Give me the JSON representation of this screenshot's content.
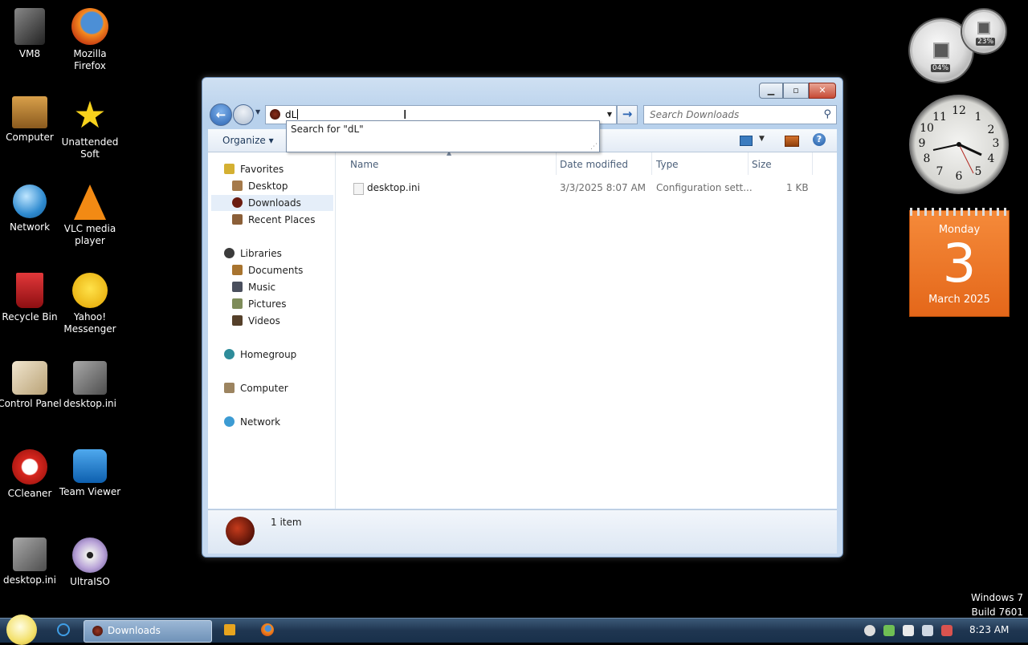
{
  "desktop": {
    "icons": [
      {
        "label": "VM8"
      },
      {
        "label": "Mozilla Firefox"
      },
      {
        "label": "Computer"
      },
      {
        "label": "Unattended Soft"
      },
      {
        "label": "Network"
      },
      {
        "label": "VLC media player"
      },
      {
        "label": "Recycle Bin"
      },
      {
        "label": "Yahoo! Messenger"
      },
      {
        "label": "Control Panel"
      },
      {
        "label": "desktop.ini"
      },
      {
        "label": "CCleaner"
      },
      {
        "label": "Team Viewer"
      },
      {
        "label": "desktop.ini"
      },
      {
        "label": "UltraISO"
      }
    ]
  },
  "gadgets": {
    "cpu_meter": {
      "cpu": "04%",
      "memory": "23%"
    },
    "clock_numbers": [
      "12",
      "1",
      "2",
      "3",
      "4",
      "5",
      "6",
      "7",
      "8",
      "9",
      "10",
      "11"
    ],
    "calendar": {
      "weekday": "Monday",
      "day": "3",
      "month_year": "March 2025"
    }
  },
  "window": {
    "address_value": "dL",
    "search_placeholder": "Search Downloads",
    "autocomplete": "Search for \"dL\"",
    "organize_label": "Organize",
    "nav": {
      "favorites": "Favorites",
      "desktop": "Desktop",
      "downloads": "Downloads",
      "recent": "Recent Places",
      "libraries": "Libraries",
      "documents": "Documents",
      "music": "Music",
      "pictures": "Pictures",
      "videos": "Videos",
      "homegroup": "Homegroup",
      "computer": "Computer",
      "network": "Network"
    },
    "columns": {
      "name": "Name",
      "date": "Date modified",
      "type": "Type",
      "size": "Size"
    },
    "files": [
      {
        "name": "desktop.ini",
        "date": "3/3/2025 8:07 AM",
        "type": "Configuration sett...",
        "size": "1 KB"
      }
    ],
    "details": {
      "count": "1 item"
    }
  },
  "taskbar": {
    "active_window": "Downloads",
    "time": "8:23 AM"
  },
  "watermark": {
    "line1": "Windows 7",
    "line2": "Build 7601"
  }
}
